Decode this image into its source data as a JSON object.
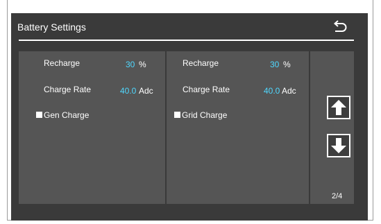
{
  "header": {
    "title": "Battery Settings",
    "back_icon": "return-arrow-icon"
  },
  "left_panel": {
    "recharge_label": "Recharge",
    "recharge_value": "30",
    "recharge_unit": "%",
    "charge_rate_label": "Charge Rate",
    "charge_rate_value": "40.0",
    "charge_rate_unit": "Adc",
    "gen_charge_label": "Gen Charge",
    "gen_charge_checked": false
  },
  "mid_panel": {
    "recharge_label": "Recharge",
    "recharge_value": "30",
    "recharge_unit": "%",
    "charge_rate_label": "Charge Rate",
    "charge_rate_value": "40.0",
    "charge_rate_unit": "Adc",
    "grid_charge_label": "Grid Charge",
    "grid_charge_checked": false
  },
  "nav": {
    "up_icon": "arrow-up-icon",
    "down_icon": "arrow-down-icon",
    "page": "2/4"
  },
  "colors": {
    "background": "#3a3a3a",
    "panel": "#555555",
    "value": "#4fd8ff",
    "text": "#ffffff"
  }
}
